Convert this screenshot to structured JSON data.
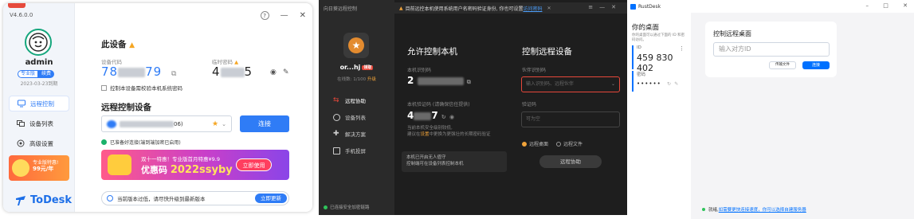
{
  "todesk": {
    "version": "V4.6.0.0",
    "username": "admin",
    "plan_a": "专业版",
    "plan_b": "续费",
    "expiry": "2023-03-23到期",
    "nav": [
      {
        "label": "远程控制",
        "icon": "monitor-icon",
        "active": true
      },
      {
        "label": "设备列表",
        "icon": "device-list-icon",
        "active": false
      },
      {
        "label": "高级设置",
        "icon": "settings-icon",
        "active": false
      }
    ],
    "promo_line1": "专业版特惠!",
    "promo_line2": "99元/年",
    "brand": "ToDesk",
    "window_controls": {
      "help": "?",
      "minimize": "—",
      "close": "✕"
    },
    "this_device": "此设备",
    "device_code_label": "设备代码",
    "device_code_start": "78",
    "device_code_end": "79",
    "temp_password_label": "临时密码",
    "temp_password_start": "4",
    "temp_password_end": "5",
    "require_password_label": "控制本设备需校验本机系统密码",
    "remote_heading": "远程控制设备",
    "remote_input_suffix": "06)",
    "connect_label": "连接",
    "ready_label": "已准备好连接(端到端加密已启用)",
    "ad_line1": "双十一特惠！专业版首月特惠¥9.9",
    "ad_line2_prefix": "优惠码 ",
    "ad_line2_code": "2022ssyby",
    "ad_button": "立即使用",
    "update_text": "当前版本过低，请尽快升级到最新版本",
    "update_button": "立即更新"
  },
  "sunlogin": {
    "title": "向日葵远程控制",
    "notice": "目前远控本机使用系统用户名密码验证身份, 你也可设置",
    "notice_link": "访问密码",
    "username": "or...hj",
    "user_tag": "领取",
    "device_count": "在线数: 1/100",
    "upgrade": "升级",
    "nav": [
      {
        "label": "远程协助",
        "icon": "remote-assist-icon",
        "active": true
      },
      {
        "label": "设备列表",
        "icon": "device-list-icon",
        "active": false
      },
      {
        "label": "解决方案",
        "icon": "solution-icon",
        "active": false
      },
      {
        "label": "手机投屏",
        "icon": "screen-cast-icon",
        "active": false
      }
    ],
    "status": "已连接安全加密链路",
    "allow_heading": "允许控制本机",
    "local_code_label": "本机识别码",
    "local_code_start": "2",
    "verify_label": "本机验证码 (请确保信任提供)",
    "verify_start": "4",
    "verify_end": "7",
    "hint_line1": "当前本机安全级别较低,",
    "hint_line2_a": "建议在",
    "hint_line2_b": "设置",
    "hint_line2_c": "中更换为更强壮的长期密码验证",
    "unattended_title": "本机已开启无人值守",
    "unattended_sub": "控制端可在设备列表控制本机",
    "control_heading": "控制远程设备",
    "partner_label": "伙伴识别码",
    "partner_placeholder": "输入识别码、远程伙伴",
    "verify2_label": "验证码",
    "verify2_placeholder": "可为空",
    "radio_desktop": "远程桌面",
    "radio_file": "远程文件",
    "assist_button": "远程协助"
  },
  "rustdesk": {
    "app_title": "RustDesk",
    "your_desktop": "你的桌面",
    "desc": "你的桌面可以通过下面的 ID 和密码访问。",
    "id_label": "ID",
    "id_value": "459 830 402",
    "password_label": "密码",
    "password_value": "••••••",
    "remote_heading": "控制远程桌面",
    "remote_placeholder": "输入对方ID",
    "transfer_button": "传输文件",
    "connect_button": "连接",
    "footer_text": "就绪, ",
    "footer_link": "如需要更快连接速度，你可以选择自建服务器"
  }
}
